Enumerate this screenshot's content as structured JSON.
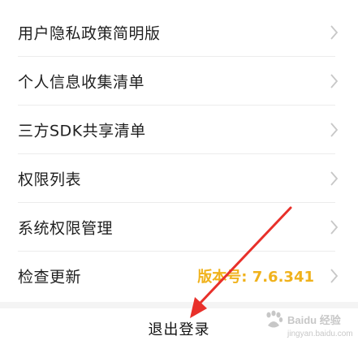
{
  "settings": {
    "items": [
      {
        "label": "用户隐私政策简明版"
      },
      {
        "label": "个人信息收集清单"
      },
      {
        "label": "三方SDK共享清单"
      },
      {
        "label": "权限列表"
      },
      {
        "label": "系统权限管理"
      },
      {
        "label": "检查更新",
        "value": "版本号: 7.6.341"
      }
    ],
    "logout_label": "退出登录"
  },
  "colors": {
    "version_text": "#f0b21c",
    "annotation_arrow": "#e8302a",
    "chevron": "#c7c7c7"
  },
  "watermark": {
    "brand": "Baidu 经验",
    "url": "jingyan.baidu.com"
  }
}
